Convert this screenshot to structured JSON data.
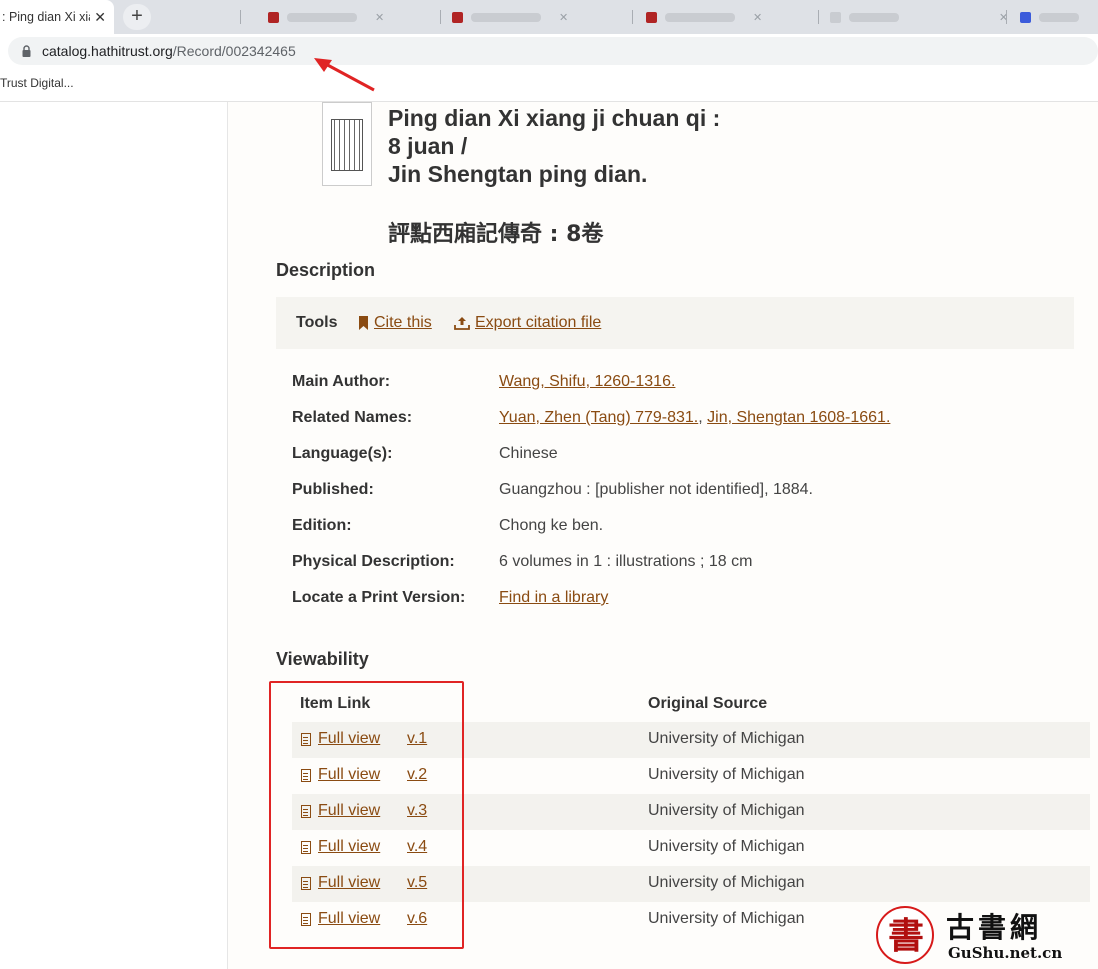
{
  "browser": {
    "active_tab_title": ": Ping dian Xi xiang ji",
    "new_tab_symbol": "+",
    "url_domain": "catalog.hathitrust.org",
    "url_path": "/Record/002342465",
    "bookmark": "Trust Digital..."
  },
  "record": {
    "title_line1": "Ping dian Xi xiang ji chuan qi :",
    "title_line2": "8 juan /",
    "title_line3": "Jin Shengtan ping dian.",
    "title_cjk": "評點西廂記傳奇 : 8卷"
  },
  "description": {
    "heading": "Description",
    "tools_label": "Tools",
    "cite_label": "Cite this",
    "export_label": "Export citation file",
    "main_author_label": "Main Author:",
    "main_author": "Wang, Shifu, 1260-1316.",
    "related_names_label": "Related Names:",
    "related_name_1": "Yuan, Zhen (Tang) 779-831.",
    "related_sep": ", ",
    "related_name_2": "Jin, Shengtan 1608-1661.",
    "language_label": "Language(s):",
    "language": "Chinese",
    "published_label": "Published:",
    "published": "Guangzhou : [publisher not identified], 1884.",
    "edition_label": "Edition:",
    "edition": "Chong ke ben.",
    "physical_label": "Physical Description:",
    "physical": "6 volumes in 1 : illustrations ; 18 cm",
    "locate_label": "Locate a Print Version:",
    "locate_link": "Find in a library"
  },
  "viewability": {
    "heading": "Viewability",
    "col_item_link": "Item Link",
    "col_source": "Original Source",
    "rows": [
      {
        "link": "Full view",
        "volume": "v.1",
        "source": "University of Michigan"
      },
      {
        "link": "Full view",
        "volume": "v.2",
        "source": "University of Michigan"
      },
      {
        "link": "Full view",
        "volume": "v.3",
        "source": "University of Michigan"
      },
      {
        "link": "Full view",
        "volume": "v.4",
        "source": "University of Michigan"
      },
      {
        "link": "Full view",
        "volume": "v.5",
        "source": "University of Michigan"
      },
      {
        "link": "Full view",
        "volume": "v.6",
        "source": "University of Michigan"
      }
    ]
  },
  "watermark": {
    "glyph": "書",
    "cjk": "古書網",
    "en": "GuShu.net.cn"
  },
  "colors": {
    "link": "#8a4b12",
    "annotation": "#e02424"
  }
}
